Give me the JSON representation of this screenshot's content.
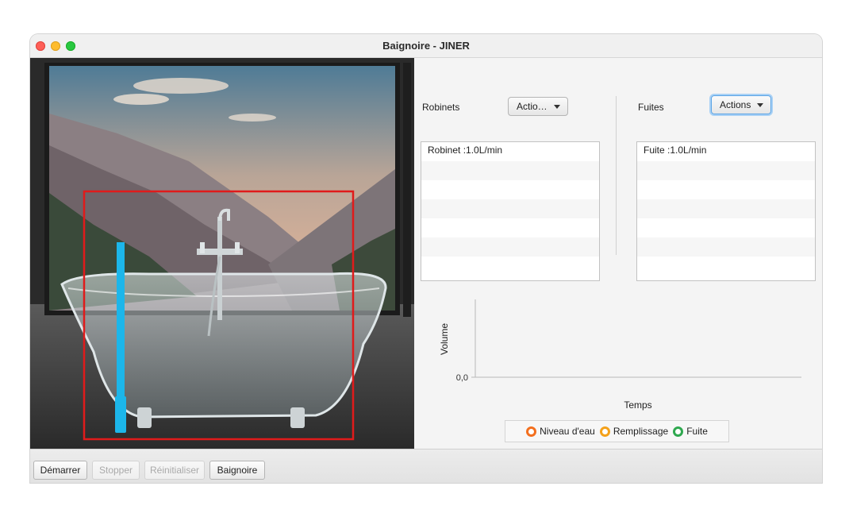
{
  "window": {
    "title": "Baignoire - JINER"
  },
  "robinets": {
    "label": "Robinets",
    "combo_label": "Actio…",
    "items": [
      "Robinet :1.0L/min"
    ]
  },
  "fuites": {
    "label": "Fuites",
    "combo_label": "Actions",
    "items": [
      "Fuite :1.0L/min"
    ]
  },
  "chart_data": {
    "type": "line",
    "title": "",
    "xlabel": "Temps",
    "ylabel": "Volume",
    "y_ticks": [
      "0,0"
    ],
    "series": [
      {
        "name": "Niveau d'eau",
        "values": [],
        "color": "#f36f1e"
      },
      {
        "name": "Remplissage",
        "values": [],
        "color": "#f4a11a"
      },
      {
        "name": "Fuite",
        "values": [],
        "color": "#2fa84f"
      }
    ]
  },
  "toolbar": {
    "start_label": "Démarrer",
    "stop_label": "Stopper",
    "reset_label": "Réinitialiser",
    "bathtub_label": "Baignoire"
  },
  "colors": {
    "water_level": "#1cb6ea",
    "bathtub_frame": "#e01b1b",
    "focus_ring": "#5aa4e6"
  },
  "icons": {
    "caret": "chevron-down-icon",
    "legend_marker": "circle-marker-icon"
  },
  "water_level_fraction": 0.85
}
